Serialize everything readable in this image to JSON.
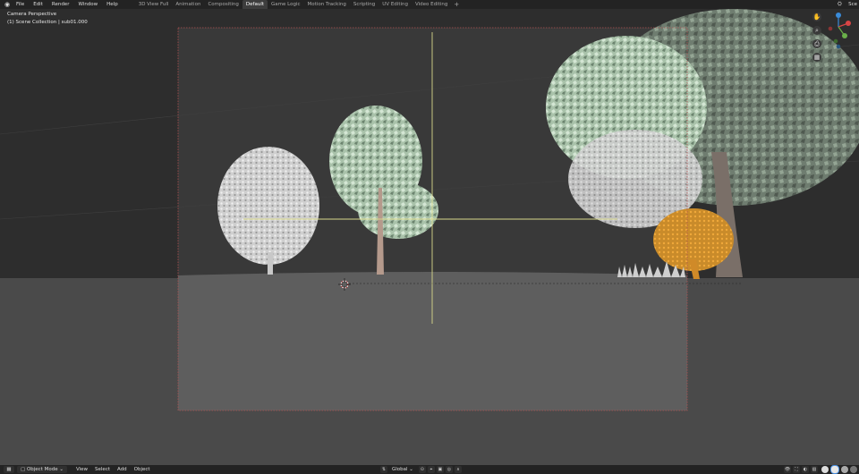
{
  "topbar": {
    "logo_icon": "blender-logo-icon",
    "menus": [
      "File",
      "Edit",
      "Render",
      "Window",
      "Help"
    ],
    "tabs": [
      "3D View Full",
      "Animation",
      "Compositing",
      "Default",
      "Game Logic",
      "Motion Tracking",
      "Scripting",
      "UV Editing",
      "Video Editing"
    ],
    "active_tab": "Default",
    "add_tab_symbol": "+",
    "scene_label": "Sce"
  },
  "viewport": {
    "camera_title": "Camera Perspective",
    "collection_info": "(1) Scene Collection | sub01.000",
    "nav_tools": [
      {
        "icon": "hand-pan-icon",
        "glyph": "✋"
      },
      {
        "icon": "zoom-icon",
        "glyph": "⌕"
      },
      {
        "icon": "camera-view-icon",
        "glyph": "⎙"
      },
      {
        "icon": "grid-view-icon",
        "glyph": "▦"
      }
    ],
    "colors": {
      "passepartout_dark": "#2d2d2d",
      "frame_background": "#393939",
      "ground": "#5e5e5e",
      "frame_border": "#b05050",
      "crosshair": "#d8d88a",
      "selected_orange": "#e0921e"
    }
  },
  "bottombar": {
    "mode_label": "Object Mode",
    "menus": [
      "View",
      "Select",
      "Add",
      "Object"
    ],
    "pivot_label": "Global"
  }
}
